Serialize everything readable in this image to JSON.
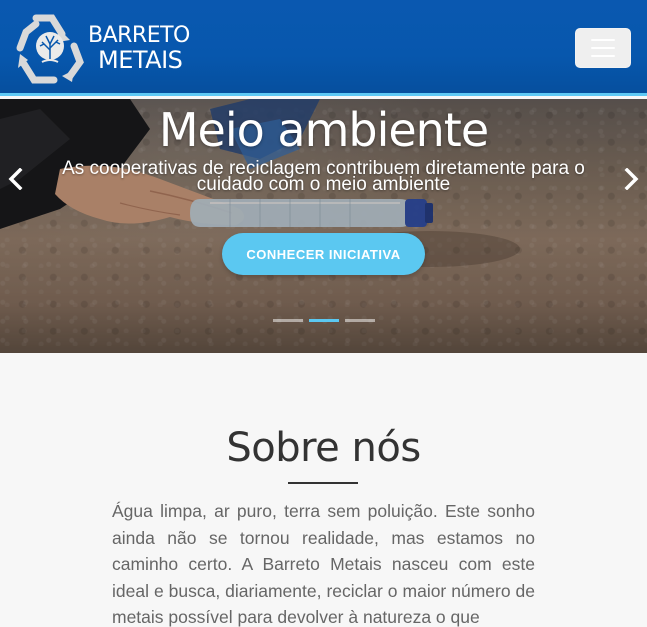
{
  "brand": {
    "name_line1": "BARRETO",
    "name_line2": "METAIS",
    "logo_icon": "recycling-tree-logo"
  },
  "nav": {
    "toggler_icon": "hamburger-menu-icon"
  },
  "hero": {
    "title": "Meio ambiente",
    "subtitle": "As cooperativas de reciclagem contribuem diretamente para o cuidado com o meio ambiente",
    "cta_label": "CONHECER INICIATIVA",
    "prev_icon": "chevron-left-icon",
    "next_icon": "chevron-right-icon",
    "slides_total": 3,
    "active_slide": 2
  },
  "about": {
    "title": "Sobre nós",
    "text": "Água limpa, ar puro, terra sem poluição. Este sonho ainda não se tornou realidade, mas estamos no caminho certo. A Barreto Metais nasceu com este ideal e busca, diariamente, reciclar o maior número de metais possível para devolver à natureza o que"
  },
  "colors": {
    "nav_bg": "#0757ad",
    "accent": "#5bc8f1",
    "body_bg": "#f7f7f7",
    "text": "#666666"
  }
}
